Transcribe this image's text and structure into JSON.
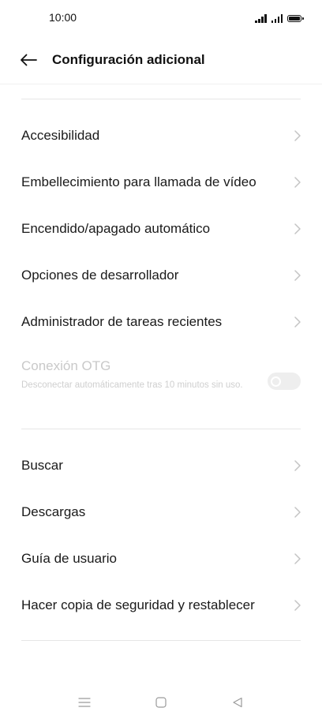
{
  "status_bar": {
    "time": "10:00"
  },
  "header": {
    "title": "Configuración adicional",
    "back_icon": "arrow-left-icon"
  },
  "section1": {
    "items": [
      {
        "label": "Accesibilidad"
      },
      {
        "label": "Embellecimiento para llamada de vídeo"
      },
      {
        "label": "Encendido/apagado automático"
      },
      {
        "label": "Opciones de desarrollador"
      },
      {
        "label": "Administrador de tareas recientes"
      }
    ]
  },
  "otg": {
    "title": "Conexión OTG",
    "description": "Desconectar automáticamente tras 10 minutos sin uso.",
    "enabled": false
  },
  "section2": {
    "items": [
      {
        "label": "Buscar"
      },
      {
        "label": "Descargas"
      },
      {
        "label": "Guía de usuario"
      },
      {
        "label": "Hacer copia de seguridad y restablecer"
      }
    ]
  },
  "nav_bar": {
    "icons": [
      "menu-icon",
      "home-icon",
      "back-triangle-icon"
    ]
  },
  "colors": {
    "text": "#1a1a1a",
    "disabled_text": "#c9c9c9",
    "chevron": "#c4c4c4",
    "divider": "#e6e6e6"
  }
}
